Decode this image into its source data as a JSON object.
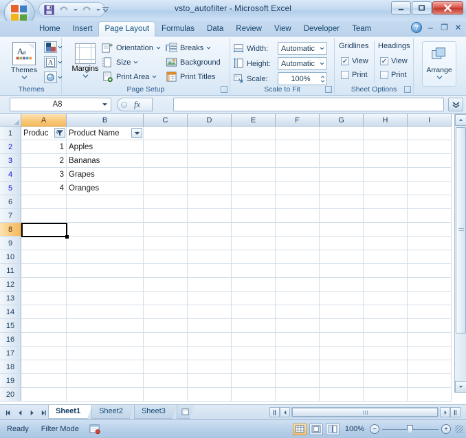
{
  "window": {
    "title": "vsto_autofilter - Microsoft Excel",
    "office_button": "office-orb",
    "qat": [
      {
        "name": "save",
        "label": "Save",
        "icon": "save-icon"
      },
      {
        "name": "undo",
        "label": "Undo",
        "icon": "undo-icon"
      },
      {
        "name": "redo",
        "label": "Redo",
        "icon": "redo-icon"
      }
    ],
    "qat_customize_label": "Customize Quick Access Toolbar",
    "controls": [
      {
        "name": "minimize",
        "glyph": "–"
      },
      {
        "name": "restore",
        "glyph": "□"
      },
      {
        "name": "close",
        "glyph": "✕"
      }
    ],
    "doc_controls": [
      {
        "name": "help",
        "glyph": "?"
      },
      {
        "name": "minimize",
        "glyph": "–"
      },
      {
        "name": "restore",
        "glyph": "❐"
      },
      {
        "name": "close",
        "glyph": "✕"
      }
    ]
  },
  "ribbon": {
    "tabs": [
      {
        "label": "Home",
        "active": false
      },
      {
        "label": "Insert",
        "active": false
      },
      {
        "label": "Page Layout",
        "active": true
      },
      {
        "label": "Formulas",
        "active": false
      },
      {
        "label": "Data",
        "active": false
      },
      {
        "label": "Review",
        "active": false
      },
      {
        "label": "View",
        "active": false
      },
      {
        "label": "Developer",
        "active": false
      },
      {
        "label": "Team",
        "active": false
      }
    ],
    "groups": {
      "themes": {
        "label": "Themes",
        "main_button": "Themes",
        "buttons": [
          {
            "label": "Colors",
            "icon": "theme-colors-icon"
          },
          {
            "label": "Fonts",
            "icon": "theme-fonts-icon"
          },
          {
            "label": "Effects",
            "icon": "theme-effects-icon"
          }
        ]
      },
      "page_setup": {
        "label": "Page Setup",
        "margins": "Margins",
        "items": [
          {
            "label": "Orientation",
            "icon": "orientation-icon",
            "dropdown": true
          },
          {
            "label": "Size",
            "icon": "size-icon",
            "dropdown": true
          },
          {
            "label": "Print Area",
            "icon": "print-area-icon",
            "dropdown": true
          },
          {
            "label": "Breaks",
            "icon": "breaks-icon",
            "dropdown": true
          },
          {
            "label": "Background",
            "icon": "background-icon",
            "dropdown": false
          },
          {
            "label": "Print Titles",
            "icon": "print-titles-icon",
            "dropdown": false
          }
        ]
      },
      "scale_to_fit": {
        "label": "Scale to Fit",
        "rows": [
          {
            "label": "Width:",
            "value": "Automatic",
            "control": "combo",
            "icon": "width-icon"
          },
          {
            "label": "Height:",
            "value": "Automatic",
            "control": "combo",
            "icon": "height-icon"
          },
          {
            "label": "Scale:",
            "value": "100%",
            "control": "spinner",
            "icon": "scale-icon"
          }
        ]
      },
      "sheet_options": {
        "label": "Sheet Options",
        "columns": [
          {
            "header": "Gridlines",
            "checks": [
              {
                "label": "View",
                "checked": true
              },
              {
                "label": "Print",
                "checked": false
              }
            ]
          },
          {
            "header": "Headings",
            "checks": [
              {
                "label": "View",
                "checked": true
              },
              {
                "label": "Print",
                "checked": false
              }
            ]
          }
        ]
      },
      "arrange": {
        "label": "Arrange",
        "button": "Arrange"
      }
    }
  },
  "formula_bar": {
    "name_box_value": "A8",
    "name_box_placeholder": "Name Box",
    "fx_symbol": "fx",
    "input_value": "",
    "input_placeholder": "",
    "expand_label": "Expand Formula Bar"
  },
  "grid": {
    "columns": [
      {
        "label": "A",
        "width": 66,
        "selected": true
      },
      {
        "label": "B",
        "width": 112,
        "selected": false
      },
      {
        "label": "C",
        "width": 64,
        "selected": false
      },
      {
        "label": "D",
        "width": 64,
        "selected": false
      },
      {
        "label": "E",
        "width": 64,
        "selected": false
      },
      {
        "label": "F",
        "width": 64,
        "selected": false
      },
      {
        "label": "G",
        "width": 64,
        "selected": false
      },
      {
        "label": "H",
        "width": 64,
        "selected": false
      },
      {
        "label": "I",
        "width": 64,
        "selected": false
      }
    ],
    "rows": [
      {
        "num": "1",
        "filtered": false,
        "selected": false
      },
      {
        "num": "2",
        "filtered": true,
        "selected": false
      },
      {
        "num": "3",
        "filtered": true,
        "selected": false
      },
      {
        "num": "4",
        "filtered": true,
        "selected": false
      },
      {
        "num": "5",
        "filtered": true,
        "selected": false
      },
      {
        "num": "6",
        "filtered": false,
        "selected": false
      },
      {
        "num": "7",
        "filtered": false,
        "selected": false
      },
      {
        "num": "8",
        "filtered": false,
        "selected": true
      },
      {
        "num": "9",
        "filtered": false,
        "selected": false
      },
      {
        "num": "10",
        "filtered": false,
        "selected": false
      },
      {
        "num": "11",
        "filtered": false,
        "selected": false
      },
      {
        "num": "12",
        "filtered": false,
        "selected": false
      },
      {
        "num": "13",
        "filtered": false,
        "selected": false
      },
      {
        "num": "14",
        "filtered": false,
        "selected": false
      },
      {
        "num": "15",
        "filtered": false,
        "selected": false
      },
      {
        "num": "16",
        "filtered": false,
        "selected": false
      },
      {
        "num": "17",
        "filtered": false,
        "selected": false
      },
      {
        "num": "18",
        "filtered": false,
        "selected": false
      },
      {
        "num": "19",
        "filtered": false,
        "selected": false
      },
      {
        "num": "20",
        "filtered": false,
        "selected": false
      }
    ],
    "header_row": {
      "a": {
        "text": "Produc",
        "filter_state": "filtered"
      },
      "b": {
        "text": "Product Name",
        "filter_state": "none"
      }
    },
    "data_rows": [
      {
        "a": "1",
        "b": "Apples"
      },
      {
        "a": "2",
        "b": "Bananas"
      },
      {
        "a": "3",
        "b": "Grapes"
      },
      {
        "a": "4",
        "b": "Oranges"
      }
    ],
    "active_cell": "A8"
  },
  "sheet_tabs": {
    "nav": [
      {
        "name": "first",
        "glyph": "◀▏"
      },
      {
        "name": "prev",
        "glyph": "◀"
      },
      {
        "name": "next",
        "glyph": "▶"
      },
      {
        "name": "last",
        "glyph": "▕▶"
      }
    ],
    "tabs": [
      {
        "label": "Sheet1",
        "active": true
      },
      {
        "label": "Sheet2",
        "active": false
      },
      {
        "label": "Sheet3",
        "active": false
      }
    ],
    "insert_label": "Insert Worksheet"
  },
  "status_bar": {
    "mode": "Ready",
    "filter_mode": "Filter Mode",
    "macro_record_label": "Record Macro",
    "views": [
      {
        "name": "normal",
        "label": "Normal",
        "active": true
      },
      {
        "name": "page-layout",
        "label": "Page Layout",
        "active": false
      },
      {
        "name": "page-break-preview",
        "label": "Page Break Preview",
        "active": false
      }
    ],
    "zoom": "100%",
    "zoom_out_glyph": "−",
    "zoom_in_glyph": "+"
  }
}
